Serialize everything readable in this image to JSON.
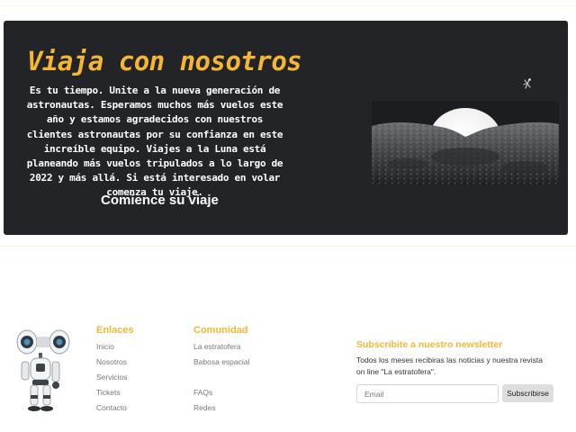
{
  "hero": {
    "title": "Viaja con nosotros",
    "body": "Es tu tiempo. Unite a la nueva generación de astronautas. Esperamos muchos más vuelos este año y estamos agradecidos con nuestros clientes astronautas por su confianza en este increíble equipo. Viajes a la Luna está planeando más vuelos tripulados a lo largo de 2022 y más allá. Si está interesado en volar comenza tu viaje.",
    "cta": "Comience su viaje",
    "image_icon": "moon-rising-over-lunar-surface-image",
    "small_icon": "floating-astronaut-icon"
  },
  "footer": {
    "robot_icon": "robot-mascot-image",
    "links": {
      "title": "Enlaces",
      "items": [
        "Inicio",
        "Nosotros",
        "Servicios",
        "Tickets",
        "Contacto"
      ]
    },
    "community": {
      "title": "Comunidad",
      "items_top": [
        "La estratofera",
        "Babosa espacial"
      ],
      "items_bottom": [
        "FAQs",
        "Redes"
      ]
    },
    "newsletter": {
      "title": "Subscribite a nuestro newsletter",
      "text": "Todos los meses recibiras las noticias y nuestra revista on line \"La estratofera\".",
      "email_placeholder": "Email",
      "button": "Subscribirse"
    }
  },
  "colors": {
    "accent": "#f6b533",
    "hero_bg": "#222428",
    "link": "#777777"
  }
}
